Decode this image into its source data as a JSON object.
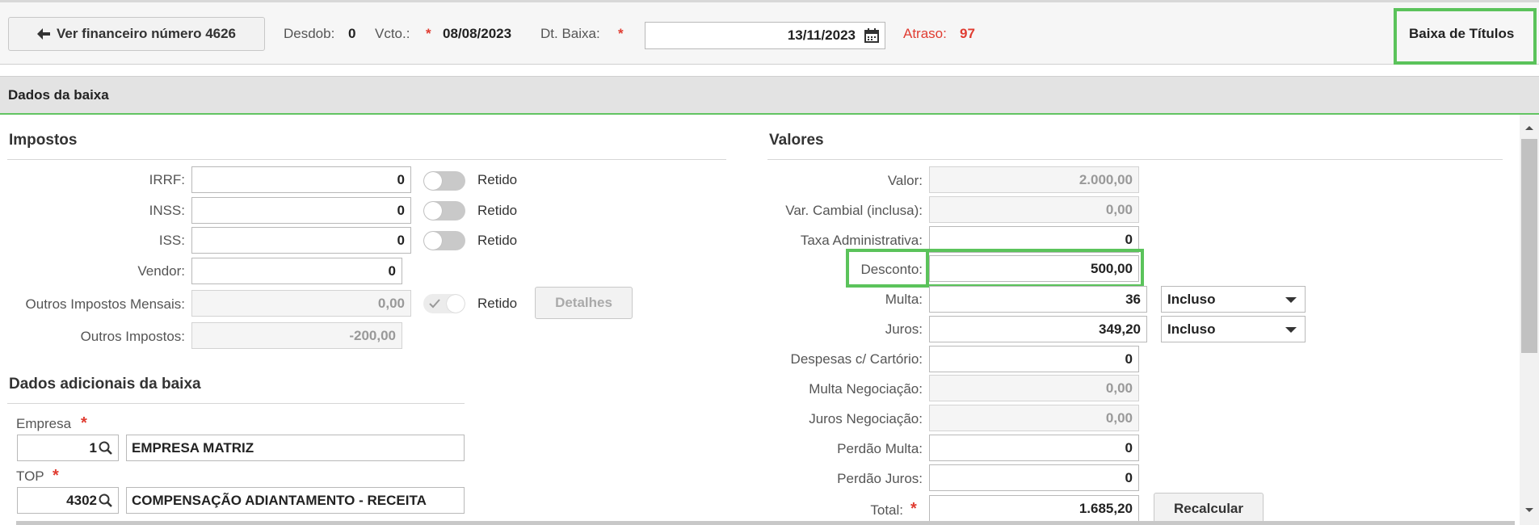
{
  "header": {
    "back_button": "Ver financeiro número 4626",
    "desdob_label": "Desdob:",
    "desdob_value": "0",
    "vcto_label": "Vcto.:",
    "vcto_value": "08/08/2023",
    "dtbaixa_label": "Dt. Baixa:",
    "dtbaixa_value": "13/11/2023",
    "atraso_label": "Atraso:",
    "atraso_value": "97",
    "title": "Baixa de Títulos",
    "required_mark": "*"
  },
  "section": {
    "title": "Dados da baixa"
  },
  "impostos": {
    "title": "Impostos",
    "retido_label": "Retido",
    "detalhes_button": "Detalhes",
    "rows": [
      {
        "label": "IRRF:",
        "value": "0"
      },
      {
        "label": "INSS:",
        "value": "0"
      },
      {
        "label": "ISS:",
        "value": "0"
      },
      {
        "label": "Vendor:",
        "value": "0"
      },
      {
        "label": "Outros Impostos Mensais:",
        "value": "0,00"
      },
      {
        "label": "Outros Impostos:",
        "value": "-200,00"
      }
    ]
  },
  "adicionais": {
    "title": "Dados adicionais da baixa",
    "empresa_label": "Empresa",
    "empresa_code": "1",
    "empresa_name": "EMPRESA MATRIZ",
    "top_label": "TOP",
    "top_code": "4302",
    "top_name": "COMPENSAÇÃO ADIANTAMENTO - RECEITA"
  },
  "valores": {
    "title": "Valores",
    "recalcular_button": "Recalcular",
    "rows": [
      {
        "label": "Valor:",
        "value": "2.000,00"
      },
      {
        "label": "Var. Cambial (inclusa):",
        "value": "0,00"
      },
      {
        "label": "Taxa Administrativa:",
        "value": "0"
      },
      {
        "label": "Desconto:",
        "value": "500,00"
      },
      {
        "label": "Multa:",
        "value": "36",
        "select": "Incluso"
      },
      {
        "label": "Juros:",
        "value": "349,20",
        "select": "Incluso"
      },
      {
        "label": "Despesas c/ Cartório:",
        "value": "0"
      },
      {
        "label": "Multa Negociação:",
        "value": "0,00"
      },
      {
        "label": "Juros Negociação:",
        "value": "0,00"
      },
      {
        "label": "Perdão Multa:",
        "value": "0"
      },
      {
        "label": "Perdão Juros:",
        "value": "0"
      },
      {
        "label": "Total:",
        "value": "1.685,20"
      }
    ]
  },
  "colors": {
    "highlight": "#5bc35b",
    "required": "#e03c31"
  }
}
